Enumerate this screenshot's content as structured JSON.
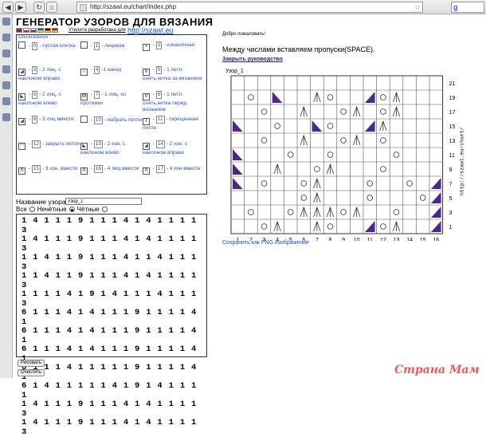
{
  "browser": {
    "url": "http://szawl.eu/chart/index.php",
    "back_glyph": "◀",
    "forward_glyph": "▶",
    "reload_glyph": "↻",
    "home_glyph": "⌂",
    "star_glyph": "☆",
    "search_engine_glyph": "g"
  },
  "header": {
    "title": "ГЕНЕРАТОР УЗОРОВ ДЛЯ ВЯЗАНИЯ",
    "app_note": "Утилита разработана для",
    "site_link": "http://szawl.eu"
  },
  "flags": [
    {
      "name": "english",
      "colors": [
        "#b22234",
        "#3c3b6e"
      ]
    },
    {
      "name": "polish",
      "colors": [
        "#ffffff",
        "#dc143c"
      ]
    },
    {
      "name": "russian",
      "colors": [
        "#ffffff",
        "#0039a6",
        "#d52b1e"
      ]
    },
    {
      "name": "ukrainian",
      "colors": [
        "#0057b7",
        "#ffd700"
      ]
    },
    {
      "name": "german",
      "colors": [
        "#000000",
        "#dd0000",
        "#ffce00"
      ]
    },
    {
      "name": "spanish",
      "colors": [
        "#aa151b",
        "#f1bf00"
      ]
    }
  ],
  "legend": {
    "title": "Обозначения",
    "items": [
      {
        "num": "0",
        "text": "- пустая клетка",
        "icon": "empty",
        "glyph": ""
      },
      {
        "num": "1",
        "text": "- лицевая",
        "icon": "knit",
        "glyph": ""
      },
      {
        "num": "2",
        "text": "- изнаночная",
        "icon": "purl-dot",
        "glyph": "•"
      },
      {
        "num": "3",
        "text": "- 2 лиц. с наклоном вправо",
        "icon": "k2tog-right-triangle",
        "glyph": "◢"
      },
      {
        "num": "4",
        "text": "-1 накид",
        "icon": "yarn-over-circle",
        "glyph": "○"
      },
      {
        "num": "5",
        "text": "- 1 петл. снять,нитка за вязанием",
        "icon": "slip-back",
        "glyph": "V"
      },
      {
        "num": "6",
        "text": "- 2 лиц. с наклоном влево",
        "icon": "ssk-left-triangle",
        "glyph": "◣"
      },
      {
        "num": "7",
        "text": "- 1 лиц. из протяжки",
        "icon": "knit-from-bar",
        "glyph": "M"
      },
      {
        "num": "8",
        "text": "- 1 петл. снять,нитка перед вязанием",
        "icon": "slip-front",
        "glyph": "V"
      },
      {
        "num": "9",
        "text": "- 3 лиц вместе",
        "icon": "k3tog",
        "glyph": "◢"
      },
      {
        "num": "10",
        "text": "- набрать петли",
        "icon": "cast-on",
        "glyph": ""
      },
      {
        "num": "11",
        "text": "- скрещенная петля",
        "icon": "crossed-stitch",
        "glyph": "ℓ"
      },
      {
        "num": "12",
        "text": "- закрыть петли",
        "icon": "bind-off",
        "glyph": "◠"
      },
      {
        "num": "13",
        "text": "- 2 изн. с наклоном влево",
        "icon": "p2tog-left",
        "glyph": "◣"
      },
      {
        "num": "14",
        "text": "- 2 изн. с наклоном вправо",
        "icon": "p2tog-right",
        "glyph": "◢"
      },
      {
        "num": "15",
        "text": "- 3 изн. вместе",
        "icon": "p3tog",
        "glyph": "Λ"
      },
      {
        "num": "16",
        "text": "- 4 лиц вместе",
        "icon": "k4tog",
        "glyph": "Λ"
      },
      {
        "num": "17",
        "text": "- 4 изн вместе",
        "icon": "p4tog",
        "glyph": "Λ"
      }
    ]
  },
  "form": {
    "name_label": "Название узора",
    "name_value": "Узор_1",
    "rows_all_label": "Все",
    "rows_odd_label": "Нечётные",
    "rows_even_label": "Чётные",
    "rows_selected": "odd",
    "pattern_lines": [
      "14111911141411113",
      "14111911141411113",
      "11411911141141113",
      "11411911141411113",
      "11114191411141113",
      "61114141119111141",
      "61114141119111141",
      "61114141119111141",
      "61114111119111141",
      "61411111419141111",
      "14111911141411113",
      "14111911141411113"
    ],
    "draw_button": "Рисовать",
    "clear_button": "Очистить"
  },
  "right": {
    "welcome": "Добро пожаловать!",
    "instruction": "Между числами вставляем пропуски(SPACE).",
    "close_guide": "Закрыть руководство",
    "save_png": "Сохранить как PNG изображение"
  },
  "chart": {
    "name": "Узор_1",
    "watermark_text": "http://szawl.eu/chart/",
    "col_labels": [
      "1",
      "2",
      "3",
      "4",
      "5",
      "6",
      "7",
      "8",
      "9",
      "10",
      "11",
      "12",
      "13",
      "14",
      "15",
      "16"
    ],
    "row_labels": [
      "21",
      "19",
      "17",
      "15",
      "13",
      "11",
      "9",
      "7",
      "5",
      "3",
      "1"
    ],
    "purple": "#4b2a86",
    "grid": [
      "0000000000000000",
      "0409001400941000",
      "0040010041041000",
      "9004009400910000",
      "0040010041040000",
      "9000400400004000",
      "9001004100040000",
      "9040041000400409",
      "0000041000400049",
      "0400411141004009",
      "0041001400941009"
    ]
  },
  "watermark": "Страна Мам"
}
